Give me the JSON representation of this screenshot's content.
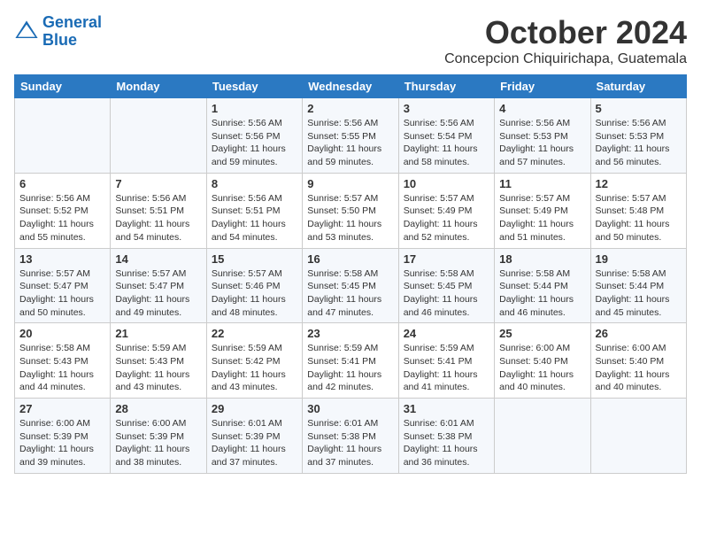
{
  "header": {
    "logo_line1": "General",
    "logo_line2": "Blue",
    "month": "October 2024",
    "location": "Concepcion Chiquirichapa, Guatemala"
  },
  "weekdays": [
    "Sunday",
    "Monday",
    "Tuesday",
    "Wednesday",
    "Thursday",
    "Friday",
    "Saturday"
  ],
  "weeks": [
    [
      {
        "day": "",
        "info": ""
      },
      {
        "day": "",
        "info": ""
      },
      {
        "day": "1",
        "info": "Sunrise: 5:56 AM\nSunset: 5:56 PM\nDaylight: 11 hours and 59 minutes."
      },
      {
        "day": "2",
        "info": "Sunrise: 5:56 AM\nSunset: 5:55 PM\nDaylight: 11 hours and 59 minutes."
      },
      {
        "day": "3",
        "info": "Sunrise: 5:56 AM\nSunset: 5:54 PM\nDaylight: 11 hours and 58 minutes."
      },
      {
        "day": "4",
        "info": "Sunrise: 5:56 AM\nSunset: 5:53 PM\nDaylight: 11 hours and 57 minutes."
      },
      {
        "day": "5",
        "info": "Sunrise: 5:56 AM\nSunset: 5:53 PM\nDaylight: 11 hours and 56 minutes."
      }
    ],
    [
      {
        "day": "6",
        "info": "Sunrise: 5:56 AM\nSunset: 5:52 PM\nDaylight: 11 hours and 55 minutes."
      },
      {
        "day": "7",
        "info": "Sunrise: 5:56 AM\nSunset: 5:51 PM\nDaylight: 11 hours and 54 minutes."
      },
      {
        "day": "8",
        "info": "Sunrise: 5:56 AM\nSunset: 5:51 PM\nDaylight: 11 hours and 54 minutes."
      },
      {
        "day": "9",
        "info": "Sunrise: 5:57 AM\nSunset: 5:50 PM\nDaylight: 11 hours and 53 minutes."
      },
      {
        "day": "10",
        "info": "Sunrise: 5:57 AM\nSunset: 5:49 PM\nDaylight: 11 hours and 52 minutes."
      },
      {
        "day": "11",
        "info": "Sunrise: 5:57 AM\nSunset: 5:49 PM\nDaylight: 11 hours and 51 minutes."
      },
      {
        "day": "12",
        "info": "Sunrise: 5:57 AM\nSunset: 5:48 PM\nDaylight: 11 hours and 50 minutes."
      }
    ],
    [
      {
        "day": "13",
        "info": "Sunrise: 5:57 AM\nSunset: 5:47 PM\nDaylight: 11 hours and 50 minutes."
      },
      {
        "day": "14",
        "info": "Sunrise: 5:57 AM\nSunset: 5:47 PM\nDaylight: 11 hours and 49 minutes."
      },
      {
        "day": "15",
        "info": "Sunrise: 5:57 AM\nSunset: 5:46 PM\nDaylight: 11 hours and 48 minutes."
      },
      {
        "day": "16",
        "info": "Sunrise: 5:58 AM\nSunset: 5:45 PM\nDaylight: 11 hours and 47 minutes."
      },
      {
        "day": "17",
        "info": "Sunrise: 5:58 AM\nSunset: 5:45 PM\nDaylight: 11 hours and 46 minutes."
      },
      {
        "day": "18",
        "info": "Sunrise: 5:58 AM\nSunset: 5:44 PM\nDaylight: 11 hours and 46 minutes."
      },
      {
        "day": "19",
        "info": "Sunrise: 5:58 AM\nSunset: 5:44 PM\nDaylight: 11 hours and 45 minutes."
      }
    ],
    [
      {
        "day": "20",
        "info": "Sunrise: 5:58 AM\nSunset: 5:43 PM\nDaylight: 11 hours and 44 minutes."
      },
      {
        "day": "21",
        "info": "Sunrise: 5:59 AM\nSunset: 5:43 PM\nDaylight: 11 hours and 43 minutes."
      },
      {
        "day": "22",
        "info": "Sunrise: 5:59 AM\nSunset: 5:42 PM\nDaylight: 11 hours and 43 minutes."
      },
      {
        "day": "23",
        "info": "Sunrise: 5:59 AM\nSunset: 5:41 PM\nDaylight: 11 hours and 42 minutes."
      },
      {
        "day": "24",
        "info": "Sunrise: 5:59 AM\nSunset: 5:41 PM\nDaylight: 11 hours and 41 minutes."
      },
      {
        "day": "25",
        "info": "Sunrise: 6:00 AM\nSunset: 5:40 PM\nDaylight: 11 hours and 40 minutes."
      },
      {
        "day": "26",
        "info": "Sunrise: 6:00 AM\nSunset: 5:40 PM\nDaylight: 11 hours and 40 minutes."
      }
    ],
    [
      {
        "day": "27",
        "info": "Sunrise: 6:00 AM\nSunset: 5:39 PM\nDaylight: 11 hours and 39 minutes."
      },
      {
        "day": "28",
        "info": "Sunrise: 6:00 AM\nSunset: 5:39 PM\nDaylight: 11 hours and 38 minutes."
      },
      {
        "day": "29",
        "info": "Sunrise: 6:01 AM\nSunset: 5:39 PM\nDaylight: 11 hours and 37 minutes."
      },
      {
        "day": "30",
        "info": "Sunrise: 6:01 AM\nSunset: 5:38 PM\nDaylight: 11 hours and 37 minutes."
      },
      {
        "day": "31",
        "info": "Sunrise: 6:01 AM\nSunset: 5:38 PM\nDaylight: 11 hours and 36 minutes."
      },
      {
        "day": "",
        "info": ""
      },
      {
        "day": "",
        "info": ""
      }
    ]
  ]
}
